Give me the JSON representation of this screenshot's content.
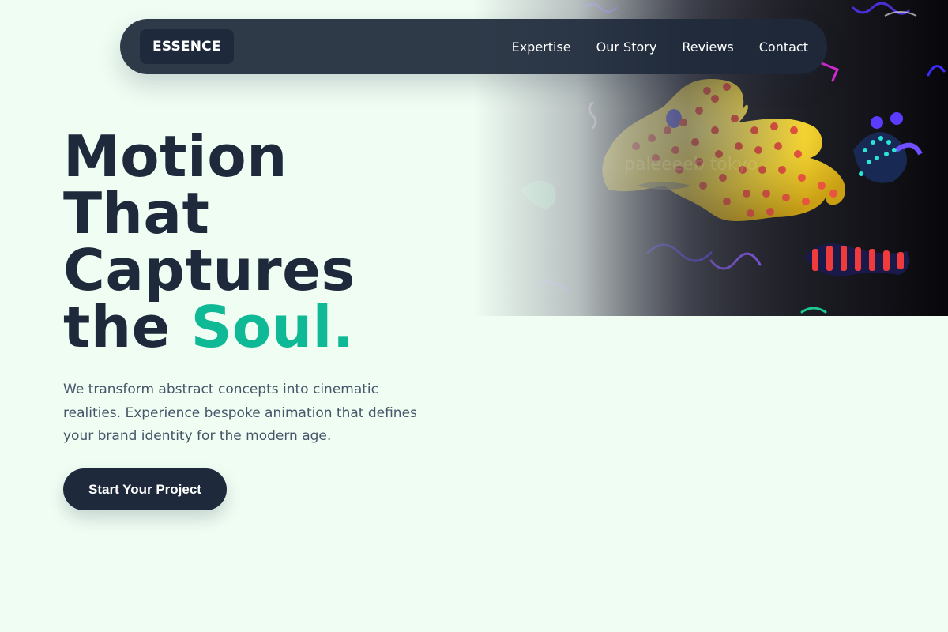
{
  "navbar": {
    "brand": "ESSENCE",
    "links": [
      "Expertise",
      "Our Story",
      "Reviews",
      "Contact"
    ]
  },
  "hero": {
    "headline_lines": [
      "Motion",
      "That",
      "Captures"
    ],
    "headline_last_prefix": "the ",
    "headline_accent": "Soul.",
    "lede": "We transform abstract concepts into cinematic realities. Experience bespoke animation that defines your brand identity for the modern age.",
    "cta_label": "Start Your Project",
    "image_watermark": "paleeeeb tokyo"
  },
  "colors": {
    "background": "#effdf3",
    "navy": "#1e293b",
    "accent": "#10b995",
    "body_text": "#475569"
  }
}
